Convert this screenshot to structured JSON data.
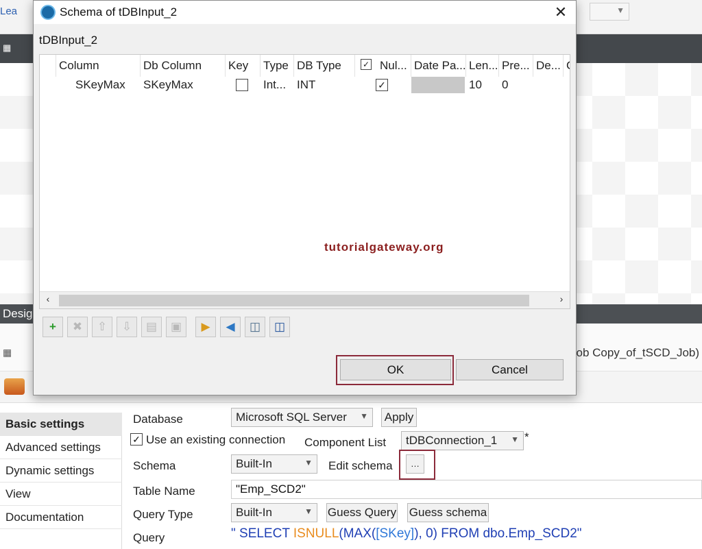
{
  "background": {
    "top_link": "Lea",
    "design_tab": "Desig",
    "job_title": "Job Copy_of_tSCD_Job)"
  },
  "settings_nav": {
    "items": [
      {
        "label": "Basic settings"
      },
      {
        "label": "Advanced settings"
      },
      {
        "label": "Dynamic settings"
      },
      {
        "label": "View"
      },
      {
        "label": "Documentation"
      }
    ]
  },
  "settings": {
    "database_label": "Database",
    "database_value": "Microsoft SQL Server",
    "apply_label": "Apply",
    "use_existing_connection_label": "Use an existing connection",
    "use_existing_connection_checked": true,
    "component_list_label": "Component List",
    "component_list_value": "tDBConnection_1",
    "required_marker": "*",
    "schema_label": "Schema",
    "schema_value": "Built-In",
    "edit_schema_label": "Edit schema",
    "edit_schema_button": "…",
    "table_name_label": "Table Name",
    "table_name_value": "\"Emp_SCD2\"",
    "query_type_label": "Query Type",
    "query_type_value": "Built-In",
    "guess_query_label": "Guess Query",
    "guess_schema_label": "Guess schema",
    "query_label": "Query",
    "query_parts": {
      "p1": "\" SELECT ",
      "p2": "ISNULL",
      "p3": "(MAX(",
      "p4": "[SKey]",
      "p5": "), 0) FROM dbo.Emp_SCD2\""
    },
    "colors": {
      "keyword": "#1f3fb4",
      "function": "#e98c1e",
      "identifier": "#2f78d8",
      "highlight_frame": "#8b2a3a"
    }
  },
  "dialog": {
    "title": "Schema of tDBInput_2",
    "component_name": "tDBInput_2",
    "close_glyph": "✕",
    "columns": {
      "column": "Column",
      "db_column": "Db Column",
      "key": "Key",
      "type": "Type",
      "db_type": "DB Type",
      "nullable": "Nul...",
      "date_pattern": "Date Pa...",
      "length": "Len...",
      "precision": "Pre...",
      "default": "De...",
      "comment": "C"
    },
    "rows": [
      {
        "column": "SKeyMax",
        "db_column": "SKeyMax",
        "key": false,
        "type": "Int...",
        "db_type": "INT",
        "nullable": true,
        "date_pattern": "",
        "length": "10",
        "precision": "0"
      }
    ],
    "watermark": "tutorialgateway.org",
    "toolbar_icons": [
      "add-icon",
      "remove-icon",
      "move-up-icon",
      "move-down-icon",
      "copy-icon",
      "paste-icon",
      "import-icon",
      "export-icon",
      "repository-icon",
      "save-icon"
    ],
    "ok_label": "OK",
    "cancel_label": "Cancel"
  }
}
